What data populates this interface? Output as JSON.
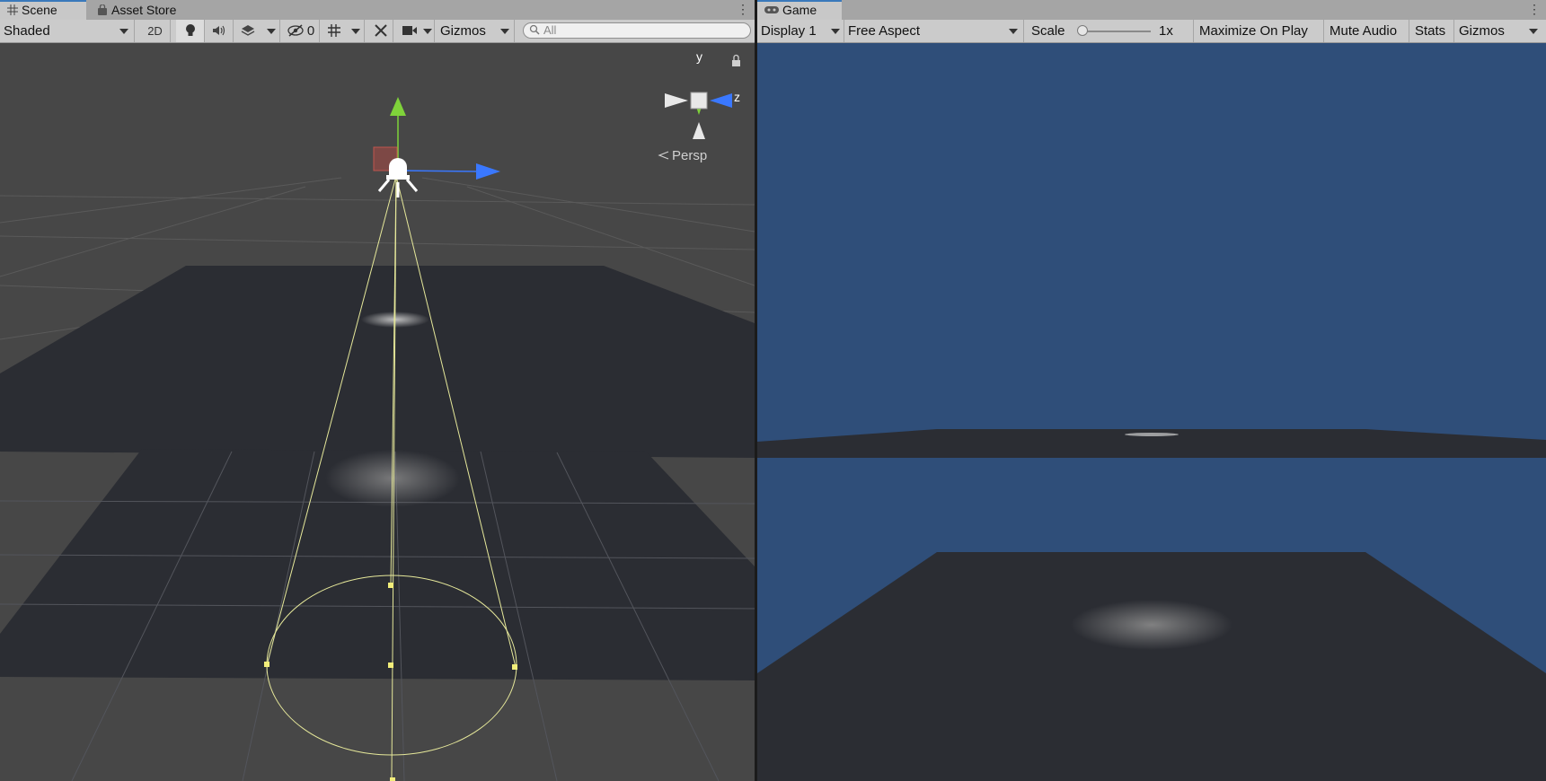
{
  "scene": {
    "tabs": [
      {
        "label": "Scene",
        "icon": "grid-icon",
        "active": true
      },
      {
        "label": "Asset Store",
        "icon": "bag-icon",
        "active": false
      }
    ],
    "toolbar": {
      "shading_mode": "Shaded",
      "mode_2d": "2D",
      "hidden_count": "0",
      "gizmos": "Gizmos",
      "search_placeholder": "All"
    },
    "orientation": {
      "y_label": "y",
      "z_label": "z",
      "projection": "Persp"
    }
  },
  "game": {
    "tabs": [
      {
        "label": "Game",
        "icon": "gamepad-icon",
        "active": true
      }
    ],
    "toolbar": {
      "display": "Display 1",
      "aspect": "Free Aspect",
      "scale_label": "Scale",
      "scale_value": "1x",
      "maximize_on_play": "Maximize On Play",
      "mute_audio": "Mute Audio",
      "stats": "Stats",
      "gizmos": "Gizmos"
    }
  },
  "colors": {
    "scene_bg": "#474747",
    "plane": "#2b2d33",
    "game_sky": "#2f4e79",
    "gizmo_y": "#7fd23a",
    "gizmo_z": "#3a78ff",
    "spotlight_cone": "#e6e89a",
    "tab_accent": "#3a79bb"
  }
}
